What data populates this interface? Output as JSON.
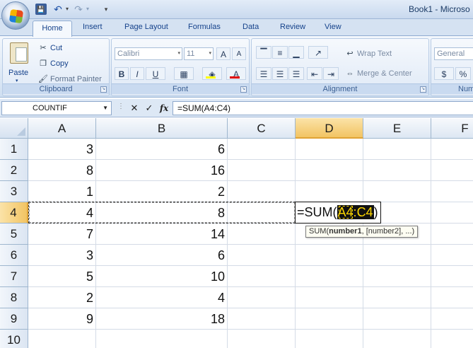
{
  "title_bar": {
    "title": "Book1 - Microso",
    "qat": {
      "save": "💾",
      "undo": "↶",
      "undo_dd": "▾",
      "redo": "↷",
      "redo_dd": "▾",
      "customize": "▾"
    }
  },
  "tabs": [
    "Home",
    "Insert",
    "Page Layout",
    "Formulas",
    "Data",
    "Review",
    "View"
  ],
  "active_tab": "Home",
  "ribbon": {
    "clipboard": {
      "label": "Clipboard",
      "paste": "Paste",
      "paste_arrow": "▾",
      "cut": "Cut",
      "copy": "Copy",
      "format_painter": "Format Painter"
    },
    "font": {
      "label": "Font",
      "font_name": "Calibri",
      "font_size": "11",
      "grow": "A",
      "shrink": "A",
      "bold": "B",
      "italic": "I",
      "underline": "U",
      "dropdown": "▾"
    },
    "alignment": {
      "label": "Alignment",
      "wrap_text": "Wrap Text",
      "merge_center": "Merge & Center"
    },
    "number": {
      "label": "Num",
      "format": "General",
      "currency": "$",
      "percent": "%"
    }
  },
  "formula_bar": {
    "name_box": "COUNTIF",
    "cancel": "✕",
    "enter": "✓",
    "fx": "fx",
    "formula": "=SUM(A4:C4)"
  },
  "sheet": {
    "columns": [
      "A",
      "B",
      "C",
      "D",
      "E",
      "F"
    ],
    "rows": [
      "1",
      "2",
      "3",
      "4",
      "5",
      "6",
      "7",
      "8",
      "9",
      "10"
    ],
    "active_column": "D",
    "active_row": "4",
    "cells": [
      [
        "3",
        "6",
        "",
        "",
        "",
        ""
      ],
      [
        "8",
        "16",
        "",
        "",
        "",
        ""
      ],
      [
        "1",
        "2",
        "",
        "",
        "",
        ""
      ],
      [
        "4",
        "8",
        "",
        "",
        "",
        ""
      ],
      [
        "7",
        "14",
        "",
        "",
        "",
        ""
      ],
      [
        "3",
        "6",
        "",
        "",
        "",
        ""
      ],
      [
        "5",
        "10",
        "",
        "",
        "",
        ""
      ],
      [
        "2",
        "4",
        "",
        "",
        "",
        ""
      ],
      [
        "9",
        "18",
        "",
        "",
        "",
        ""
      ],
      [
        "",
        "",
        "",
        "",
        "",
        ""
      ]
    ]
  },
  "editing": {
    "prefix": "=SUM(",
    "ref_a": "A4",
    "ref_sep": ":",
    "ref_b": "C4",
    "suffix": ")"
  },
  "tooltip": {
    "fn": "SUM(",
    "arg1": "number1",
    "rest": ", [number2], ...)"
  },
  "colors": {
    "header_active": "#f2c463",
    "ref_text": "#ffd800",
    "ribbon_text": "#15428b"
  }
}
